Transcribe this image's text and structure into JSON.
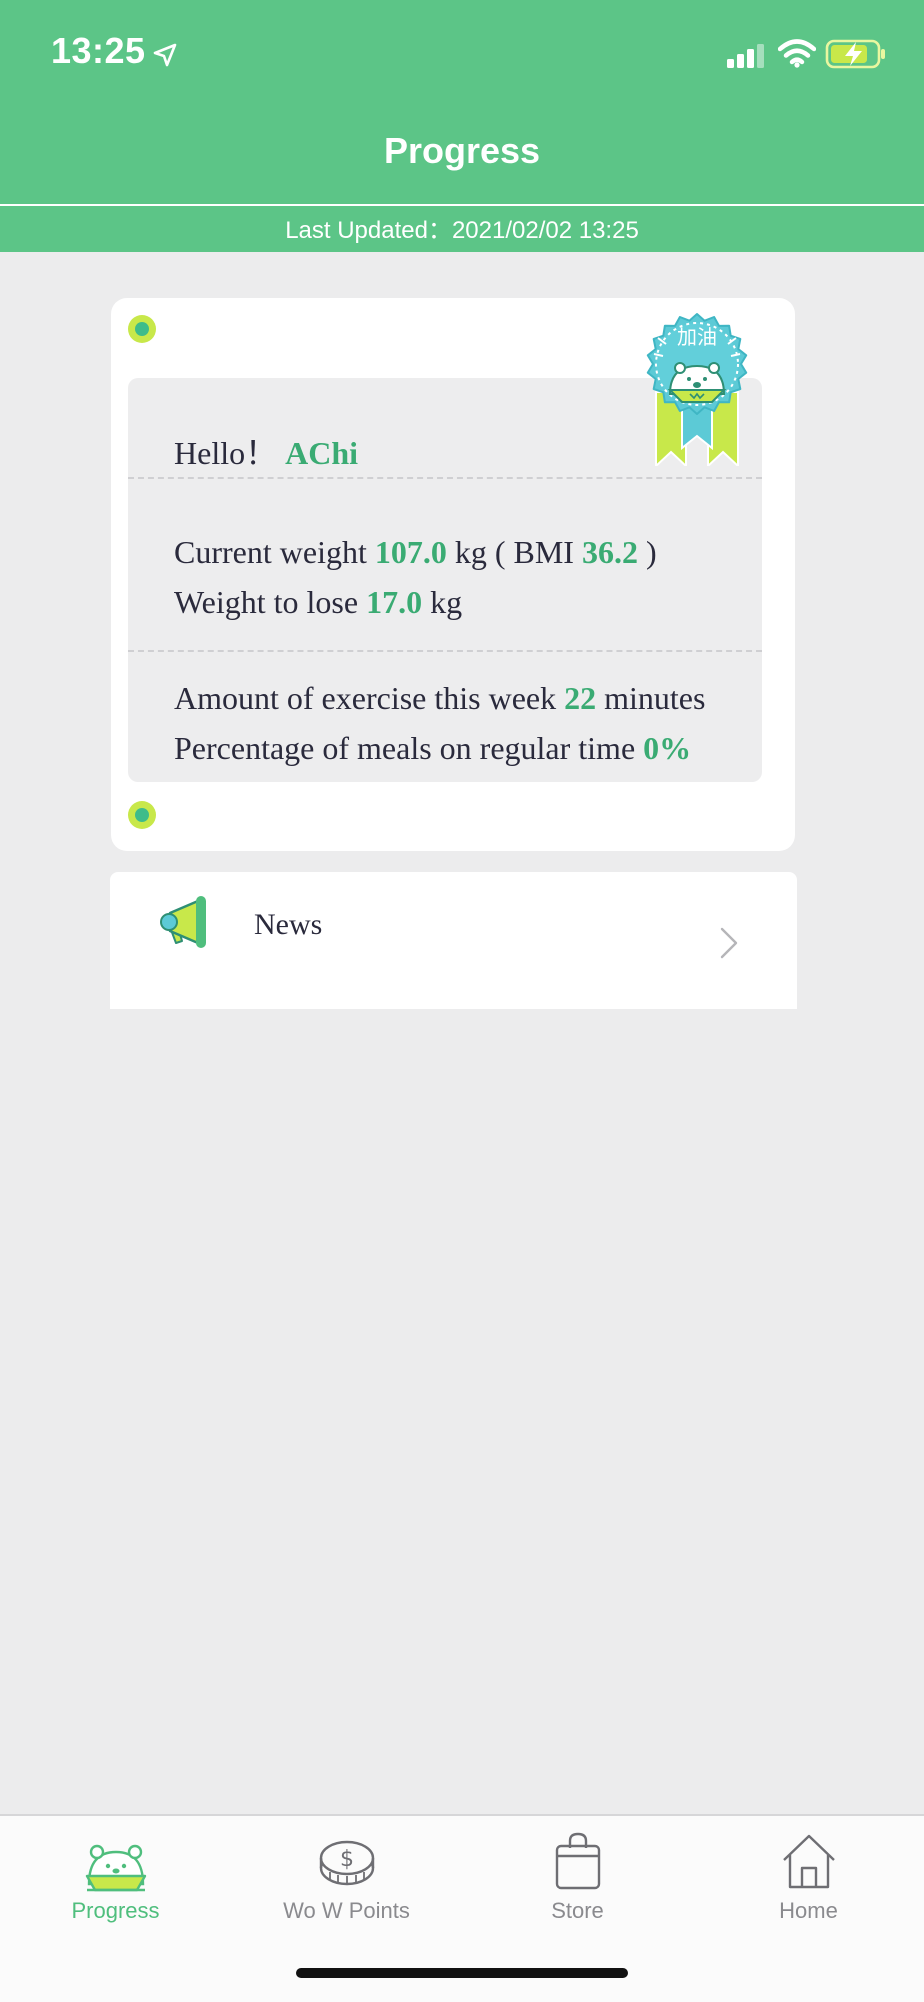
{
  "status_bar": {
    "time": "13:25",
    "icons": [
      "location-arrow-icon",
      "signal-bars-icon",
      "wifi-icon",
      "battery-charging-icon"
    ]
  },
  "header": {
    "title": "Progress",
    "last_updated": "Last Updated：2021/02/02 13:25"
  },
  "summary": {
    "greeting_prefix": "Hello！",
    "user_name": "AChi",
    "badge_text": "加油",
    "current_weight_label": "Current weight",
    "current_weight_value": "107.0",
    "weight_unit": "kg",
    "bmi_open": "( BMI",
    "bmi_value": "36.2",
    "bmi_close": ")",
    "lose_label": "Weight to lose",
    "lose_value": "17.0",
    "lose_unit": "kg",
    "exercise_label": "Amount of exercise this week",
    "exercise_value": "22",
    "exercise_unit": "minutes",
    "meals_label": "Percentage of meals on regular time",
    "meals_value": "0%"
  },
  "news": {
    "label": "News"
  },
  "tabbar": {
    "items": [
      {
        "label": "Progress",
        "icon": "bear-face-icon",
        "active": true
      },
      {
        "label": "Wo W Points",
        "icon": "coin-dollar-icon",
        "active": false
      },
      {
        "label": "Store",
        "icon": "shopping-bag-icon",
        "active": false
      },
      {
        "label": "Home",
        "icon": "house-icon",
        "active": false
      }
    ]
  },
  "colors": {
    "brand_green": "#5cc587",
    "highlight_green": "#3aab73",
    "accent_lime": "#c8e84a",
    "badge_teal": "#5ccad6",
    "inactive_gray": "#8a8a8e",
    "page_background": "#ececed"
  }
}
